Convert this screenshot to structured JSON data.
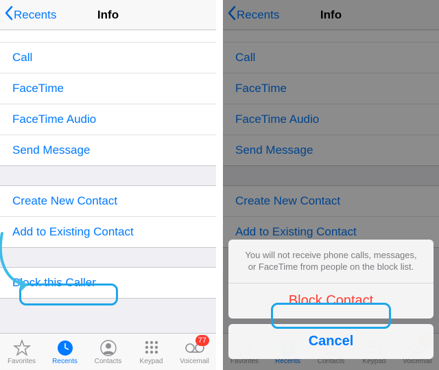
{
  "left": {
    "nav": {
      "back": "Recents",
      "title": "Info"
    },
    "actions1": [
      "Call",
      "FaceTime",
      "FaceTime Audio",
      "Send Message"
    ],
    "actions2": [
      "Create New Contact",
      "Add to Existing Contact"
    ],
    "actions3": [
      "Block this Caller"
    ],
    "tabs": {
      "favorites": "Favorites",
      "recents": "Recents",
      "contacts": "Contacts",
      "keypad": "Keypad",
      "voicemail": "Voicemail",
      "voicemail_badge": "77"
    }
  },
  "right": {
    "nav": {
      "back": "Recents",
      "title": "Info"
    },
    "actions1": [
      "Call",
      "FaceTime",
      "FaceTime Audio",
      "Send Message"
    ],
    "actions2": [
      "Create New Contact",
      "Add to Existing Contact"
    ],
    "sheet": {
      "message": "You will not receive phone calls, messages, or FaceTime from people on the block list.",
      "block": "Block Contact",
      "cancel": "Cancel"
    }
  }
}
